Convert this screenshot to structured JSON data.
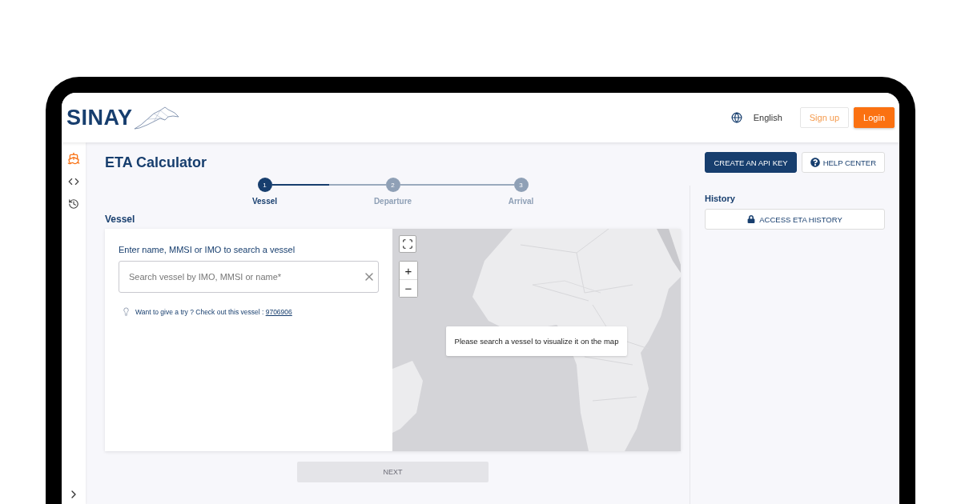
{
  "logo": {
    "text": "SINAY"
  },
  "header": {
    "language": "English",
    "buttons": [
      {
        "label": "Sign up",
        "kind": "outline"
      },
      {
        "label": "Login",
        "kind": "primary"
      }
    ]
  },
  "sidebar": {
    "items": [
      {
        "kind": "ship",
        "selected": true
      },
      {
        "kind": "code",
        "selected": false
      },
      {
        "kind": "history",
        "selected": false
      }
    ],
    "expand": {
      "kind": "chevron"
    }
  },
  "page": {
    "title": "ETA Calculator",
    "actions": [
      {
        "label": "CREATE AN API KEY",
        "kind": "primary"
      },
      {
        "label": "HELP CENTER",
        "kind": "help"
      }
    ]
  },
  "stepper": [
    {
      "number": "1",
      "label": "Vessel",
      "selected": true
    },
    {
      "number": "2",
      "label": "Departure",
      "selected": false
    },
    {
      "number": "3",
      "label": "Arrival",
      "selected": false
    }
  ],
  "section_title": "Vessel",
  "search": {
    "label": "Enter name, MMSI or IMO to search a vessel",
    "placeholder": "Search vessel by IMO, MMSI or name*"
  },
  "hint": {
    "text": "Want to give a try ? Check out this vessel : ",
    "link": "9706906"
  },
  "map": {
    "kind": "picture",
    "zoom_in": "+",
    "zoom_out": "−",
    "message": "Please search a vessel to visualize it on the map"
  },
  "next_button": {
    "label": "NEXT",
    "disabled": true
  },
  "history": {
    "title": "History",
    "button": "ACCESS ETA HISTORY"
  }
}
